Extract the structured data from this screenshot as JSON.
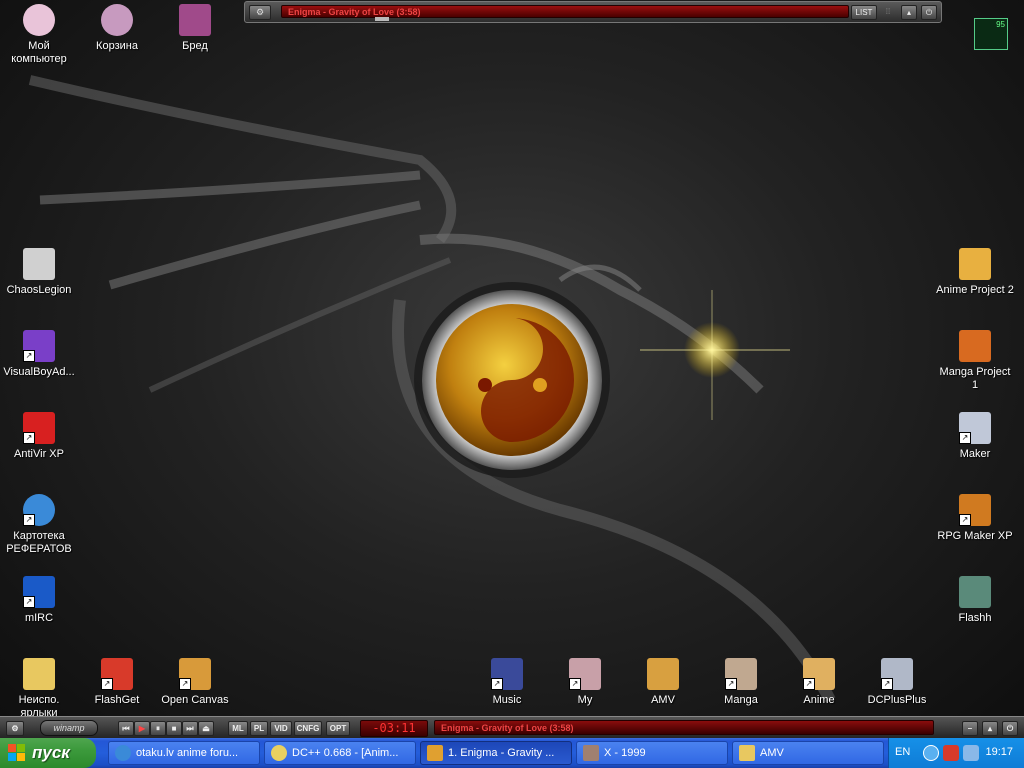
{
  "desktop": {
    "icons_left": [
      {
        "label": "Мой компьютер",
        "icon": "my-computer-icon",
        "color": "#e9c4d9"
      },
      {
        "label": "Корзина",
        "icon": "recycle-bin-icon",
        "color": "#c79abf"
      },
      {
        "label": "Бред",
        "icon": "folder-icon",
        "color": "#a04a8a"
      },
      {
        "label": "ChaosLegion",
        "icon": "chaoslegion-icon",
        "color": "#d0d0d0"
      },
      {
        "label": "VisualBoyAd...",
        "icon": "visualboy-icon",
        "color": "#7a3fc8"
      },
      {
        "label": "AntiVir XP",
        "icon": "antivir-icon",
        "color": "#d82020"
      },
      {
        "label": "Картотека РЕФЕРАТОВ",
        "icon": "ie-icon",
        "color": "#3a8ad8"
      },
      {
        "label": "mIRC",
        "icon": "mirc-icon",
        "color": "#1a5ac8"
      },
      {
        "label": "Неиспо. ярлыки",
        "icon": "shortcuts-folder-icon",
        "color": "#e8c860"
      },
      {
        "label": "FlashGet",
        "icon": "flashget-icon",
        "color": "#d83a2a"
      },
      {
        "label": "Open Canvas",
        "icon": "open-canvas-icon",
        "color": "#d89a3a"
      }
    ],
    "icons_right": [
      {
        "label": "Anime Project 2",
        "icon": "anime-project-icon",
        "color": "#e8b040"
      },
      {
        "label": "Manga Project 1",
        "icon": "manga-project-icon",
        "color": "#d86a20"
      },
      {
        "label": "Maker",
        "icon": "maker-icon",
        "color": "#c0c8d8"
      },
      {
        "label": "RPG Maker XP",
        "icon": "rpg-maker-icon",
        "color": "#d07a20"
      },
      {
        "label": "Flashh",
        "icon": "flashh-icon",
        "color": "#5a8a7a"
      }
    ],
    "icons_bottom": [
      {
        "label": "Music",
        "icon": "music-icon",
        "color": "#3a4a9a"
      },
      {
        "label": "My",
        "icon": "my-icon",
        "color": "#c8a0a8"
      },
      {
        "label": "AMV",
        "icon": "amv-icon",
        "color": "#d8a040"
      },
      {
        "label": "Manga",
        "icon": "manga-icon",
        "color": "#c0a890"
      },
      {
        "label": "Anime",
        "icon": "anime-icon",
        "color": "#e0b060"
      },
      {
        "label": "DCPlusPlus",
        "icon": "dcplusplus-icon",
        "color": "#b0b8c8"
      }
    ]
  },
  "winamp_top": {
    "menu": "⚙",
    "title": "Enigma - Gravity of Love (3:58)",
    "list_label": "LIST"
  },
  "cpu_monitor": {
    "value": "95"
  },
  "winamp_bottom": {
    "logo": "winamp",
    "controls": [
      "⏮",
      "▶",
      "⏸",
      "■",
      "⏭",
      "⏏"
    ],
    "buttons": [
      "ML",
      "PL",
      "VID",
      "CNFG",
      "OPT"
    ],
    "time": "-03:11",
    "title": "Enigma - Gravity of Love (3:58)"
  },
  "taskbar": {
    "start_label": "пуск",
    "tasks": [
      {
        "label": "otaku.lv anime foru...",
        "active": false,
        "icon": "ie-icon",
        "color": "#3a8ad8"
      },
      {
        "label": "DC++ 0.668 - [Anim...",
        "active": false,
        "icon": "dcplusplus-icon",
        "color": "#e8d060"
      },
      {
        "label": "1. Enigma - Gravity ...",
        "active": true,
        "icon": "winamp-icon",
        "color": "#e0a030"
      },
      {
        "label": "X - 1999",
        "active": false,
        "icon": "image-icon",
        "color": "#a08070"
      },
      {
        "label": "AMV",
        "active": false,
        "icon": "folder-icon",
        "color": "#e8c860"
      }
    ],
    "tray": {
      "lang": "EN",
      "clock": "19:17"
    }
  }
}
